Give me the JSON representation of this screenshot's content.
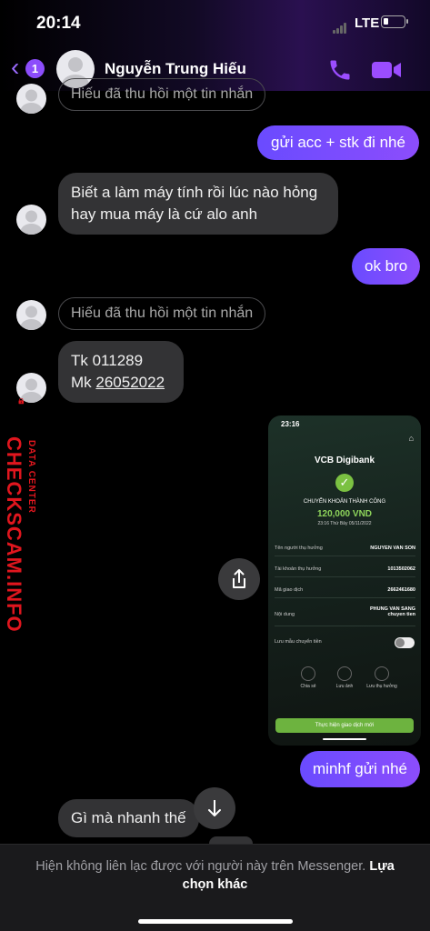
{
  "status_bar": {
    "time": "20:14",
    "network": "LTE"
  },
  "header": {
    "badge_count": "1",
    "contact_name": "Nguyễn Trung Hiếu"
  },
  "messages": {
    "unsent_notice_top": "Hiếu đã thu hồi một tin nhắn",
    "out_1": "gửi acc + stk đi nhé",
    "in_1": "Biết a làm máy tính rồi lúc nào hỏng hay mua máy là cứ alo anh",
    "out_2": "ok bro",
    "unsent_notice": "Hiếu đã thu hồi một tin nhắn",
    "in_2_line1": "Tk 011289",
    "in_2_line2_prefix": "Mk ",
    "in_2_line2_link": "26052022",
    "out_3": "minhf gửi nhé",
    "in_3": "Gì mà nhanh thế"
  },
  "attachment": {
    "time": "23:16",
    "brand": "VCB Digibank",
    "title": "CHUYỂN KHOẢN THÀNH CÔNG",
    "amount": "120,000 VND",
    "date": "23:16 Thứ Bảy 05/11/2022",
    "rows": [
      {
        "k": "Tên người thụ hưởng",
        "v": "NGUYEN VAN SON"
      },
      {
        "k": "Tài khoản thụ hưởng",
        "v": "1013502062"
      },
      {
        "k": "Mã giao dịch",
        "v": "2662461680"
      },
      {
        "k": "Nội dung",
        "v": "PHUNG VAN SANG chuyen tien"
      }
    ],
    "save_template": "Lưu mẫu chuyển tiền",
    "actions": [
      "Chia sẻ",
      "Lưu ảnh",
      "Lưu thụ hưởng"
    ],
    "cta": "Thực hiện giao dịch mới"
  },
  "watermark": {
    "main": "CHECKSCAM.INFO",
    "sub": "DATA CENTER"
  },
  "footer": {
    "text": "Hiện không liên lạc được với người này trên Messenger. ",
    "link": "Lựa chọn khác"
  }
}
